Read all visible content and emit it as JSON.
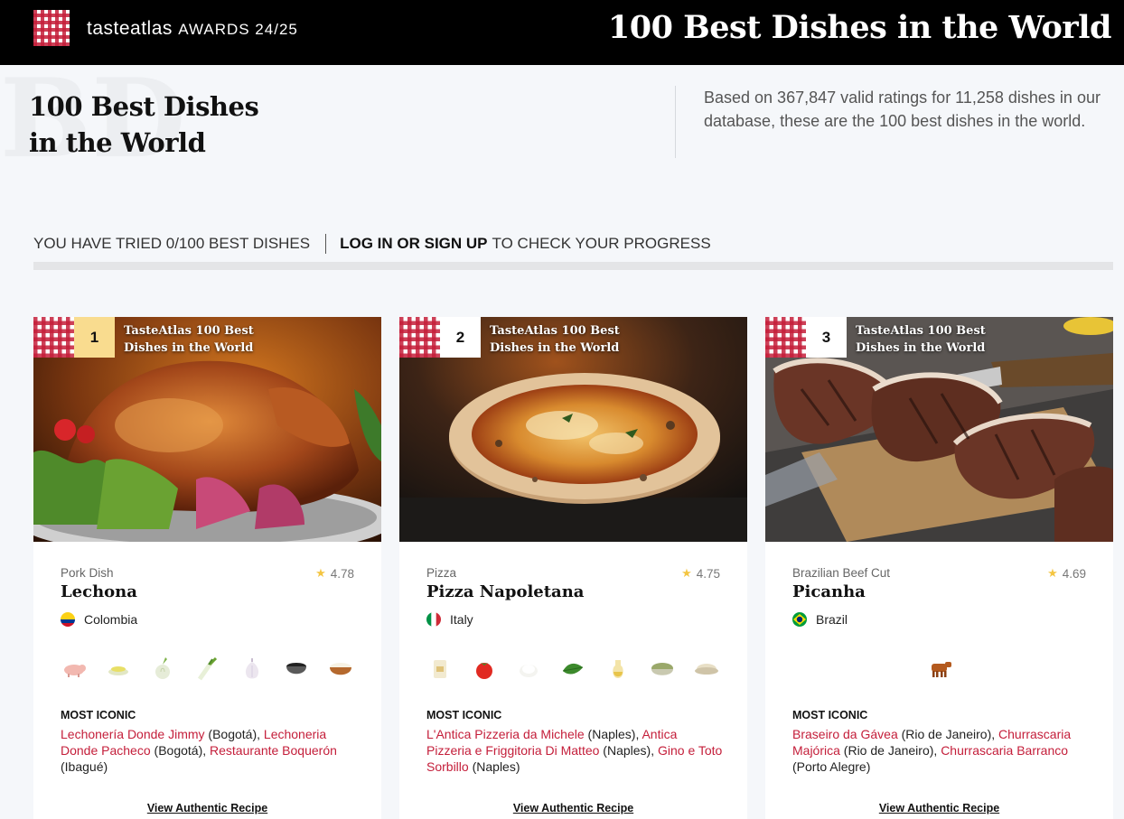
{
  "topbar": {
    "brand_taste": "tasteatlas",
    "brand_awards": "AWARDS 24/25",
    "title": "100 Best Dishes in the World"
  },
  "header": {
    "title_line1": "100 Best Dishes",
    "title_line2": "in the World",
    "intro": "Based on 367,847 valid ratings for 11,258 dishes in our database, these are the 100 best dishes in the world."
  },
  "progress": {
    "tried_text": "YOU HAVE TRIED 0/100 BEST DISHES",
    "login_text": "LOG IN OR SIGN UP",
    "check_text": "TO CHECK YOUR PROGRESS",
    "tried_fraction": 0
  },
  "cards": [
    {
      "rank": "1",
      "badge": "TasteAtlas 100 Best Dishes in the World",
      "category": "Pork Dish",
      "rating": "4.78",
      "name": "Lechona",
      "country": "Colombia",
      "ingredient_icons": [
        "pig-icon",
        "cheese-icon",
        "onion-icon",
        "green-onion-icon",
        "garlic-icon",
        "pepper-bowl-icon",
        "rice-bowl-icon"
      ],
      "most_iconic_label": "MOST ICONIC",
      "places": [
        {
          "name": "Lechonería Donde Jimmy",
          "city": "(Bogotá)"
        },
        {
          "name": "Lechoneria Donde Pacheco",
          "city": "(Bogotá)"
        },
        {
          "name": "Restaurante Boquerón",
          "city": "(Ibagué)"
        }
      ],
      "recipe_label": "View Authentic Recipe"
    },
    {
      "rank": "2",
      "badge": "TasteAtlas 100 Best Dishes in the World",
      "category": "Pizza",
      "rating": "4.75",
      "name": "Pizza Napoletana",
      "country": "Italy",
      "ingredient_icons": [
        "flour-bag-icon",
        "tomato-icon",
        "mozzarella-icon",
        "basil-icon",
        "olive-oil-icon",
        "oregano-bowl-icon",
        "salt-bowl-icon"
      ],
      "most_iconic_label": "MOST ICONIC",
      "places": [
        {
          "name": "L'Antica Pizzeria da Michele",
          "city": "(Naples)"
        },
        {
          "name": "Antica Pizzeria e Friggitoria Di Matteo",
          "city": "(Naples)"
        },
        {
          "name": "Gino e Toto Sorbillo",
          "city": "(Naples)"
        }
      ],
      "recipe_label": "View Authentic Recipe"
    },
    {
      "rank": "3",
      "badge": "TasteAtlas 100 Best Dishes in the World",
      "category": "Brazilian Beef Cut",
      "rating": "4.69",
      "name": "Picanha",
      "country": "Brazil",
      "ingredient_icons": [
        "cow-icon"
      ],
      "most_iconic_label": "MOST ICONIC",
      "places": [
        {
          "name": "Braseiro da Gávea",
          "city": "(Rio de Janeiro)"
        },
        {
          "name": "Churrascaria Majórica",
          "city": "(Rio de Janeiro)"
        },
        {
          "name": "Churrascaria Barranco",
          "city": "(Porto Alegre)"
        }
      ],
      "recipe_label": "View Authentic Recipe"
    }
  ]
}
